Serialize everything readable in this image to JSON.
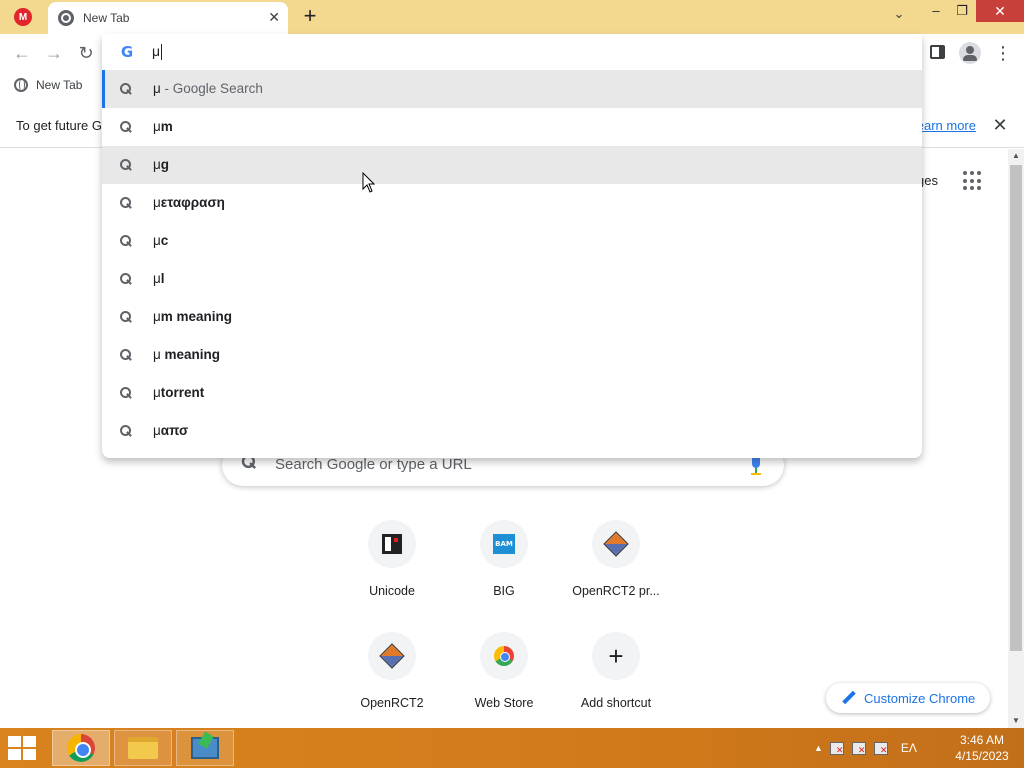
{
  "window": {
    "tabs": [
      {
        "label": "New Tab",
        "active": true
      }
    ],
    "pinned_tab_letter": "M",
    "new_tab_symbol": "+",
    "tab_close_symbol": "✕",
    "tab_search_symbol": "⌄",
    "controls": {
      "minimize": "–",
      "maximize": "❐",
      "close": "✕"
    }
  },
  "toolbar": {
    "back": "←",
    "forward": "→",
    "reload": "↻",
    "menu": "⋮"
  },
  "omnibox": {
    "input_value": "μ",
    "logo": "G",
    "suggestions": [
      {
        "typed": "μ",
        "completion": "",
        "suffix": " - Google Search",
        "state": "selected"
      },
      {
        "typed": "μ",
        "completion": "m",
        "suffix": "",
        "state": "normal"
      },
      {
        "typed": "μ",
        "completion": "g",
        "suffix": "",
        "state": "hover"
      },
      {
        "typed": "μ",
        "completion": "εταφραση",
        "suffix": "",
        "state": "normal"
      },
      {
        "typed": "μ",
        "completion": "c",
        "suffix": "",
        "state": "normal"
      },
      {
        "typed": "μ",
        "completion": "l",
        "suffix": "",
        "state": "normal"
      },
      {
        "typed": "μ",
        "completion": "m meaning",
        "suffix": "",
        "state": "normal"
      },
      {
        "typed": "μ ",
        "completion": "meaning",
        "suffix": "",
        "state": "normal"
      },
      {
        "typed": "μ",
        "completion": "torrent",
        "suffix": "",
        "state": "normal"
      },
      {
        "typed": "μ",
        "completion": "απσ",
        "suffix": "",
        "state": "normal"
      }
    ]
  },
  "bookmarks": {
    "items": [
      {
        "label": "New Tab",
        "icon": "globe-icon"
      }
    ]
  },
  "infobar": {
    "text": "To get future G",
    "link": "Learn more",
    "close": "✕"
  },
  "ntp": {
    "images_link": "Images",
    "search_placeholder": "Search Google or type a URL",
    "shortcuts": [
      {
        "label": "Unicode",
        "icon": "unicode-icon"
      },
      {
        "label": "BIG",
        "icon": "bam-icon",
        "icon_text": "BAM"
      },
      {
        "label": "OpenRCT2 pr...",
        "icon": "openrct2-icon"
      },
      {
        "label": "OpenRCT2",
        "icon": "openrct2-icon"
      },
      {
        "label": "Web Store",
        "icon": "web-store-icon"
      },
      {
        "label": "Add shortcut",
        "icon": "plus-icon",
        "icon_text": "+"
      }
    ],
    "customize_label": "Customize Chrome"
  },
  "taskbar": {
    "language": "ΕΛ",
    "time": "3:46 AM",
    "date": "4/15/2023",
    "tray_up": "▲"
  },
  "colors": {
    "titlebar": "#f3d990",
    "accent": "#1a73e8",
    "taskbar": "#d9831f",
    "close_button": "#c7403a"
  }
}
